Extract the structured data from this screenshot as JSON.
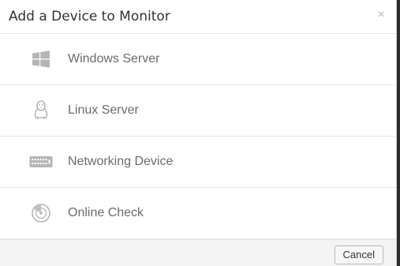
{
  "dialog": {
    "title": "Add a Device to Monitor",
    "close_symbol": "×"
  },
  "devices": [
    {
      "label": "Windows Server",
      "icon": "windows-icon"
    },
    {
      "label": "Linux Server",
      "icon": "linux-tux-icon"
    },
    {
      "label": "Networking Device",
      "icon": "network-switch-icon"
    },
    {
      "label": "Online Check",
      "icon": "online-check-radar-icon"
    }
  ],
  "footer": {
    "cancel_label": "Cancel"
  },
  "colors": {
    "icon": "#b5b5b5",
    "label": "#6b6b6b",
    "divider": "#e5e5e5",
    "footer_bg": "#f3f3f3"
  }
}
